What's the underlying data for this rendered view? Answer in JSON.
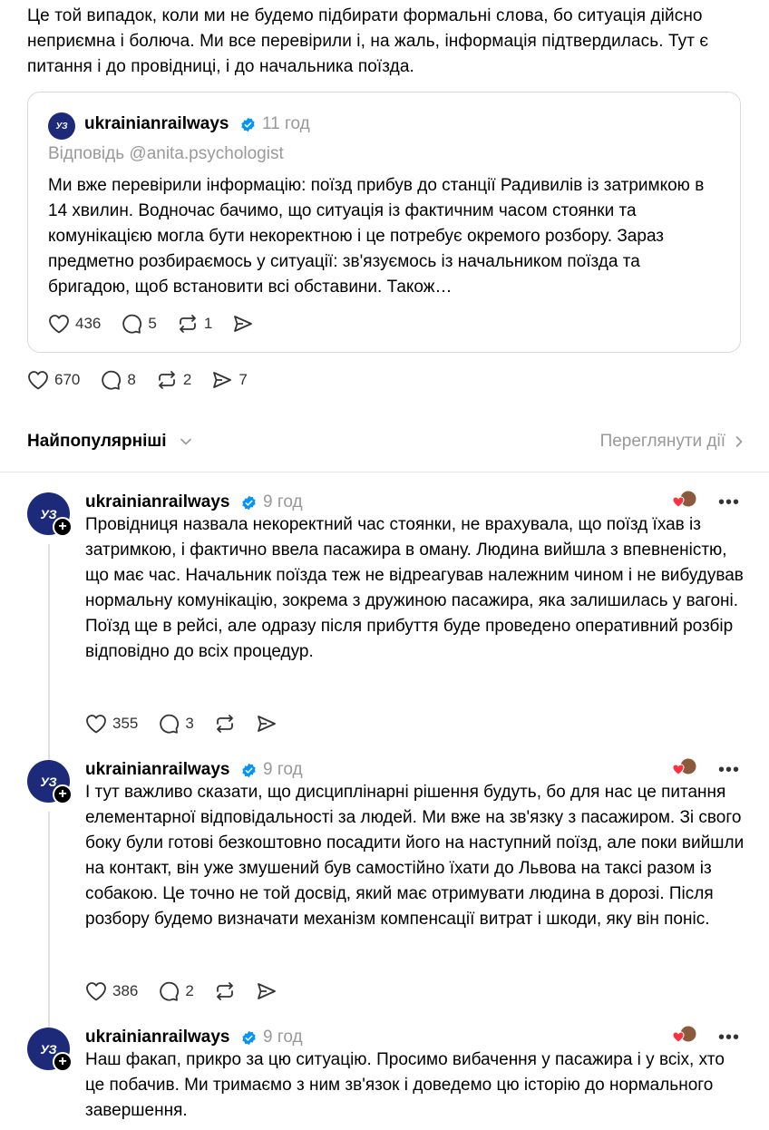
{
  "intro_text": "Це той випадок, коли ми не будемо підбирати формальні слова, бо ситуація дійсно неприємна і болюча. Ми все перевірили і, на жаль, інформація підтвердилась. Тут є питання і до провідниці, і до начальника поїзда.",
  "quoted_post": {
    "username": "ukrainianrailways",
    "time": "11 год",
    "reply_to": "Відповідь @anita.psychologist",
    "text": "Ми вже перевірили інформацію: поїзд прибув до станції Радивилів із затримкою в 14 хвилин. Водночас бачимо, що ситуація із фактичним часом стоянки та комунікацією могла бути некоректною і це потребує окремого розбору. Зараз предметно розбираємось у ситуації: зв'язуємось із начальником поїзда та бригадою, щоб встановити всі обставини. Також…",
    "likes": "436",
    "comments": "5",
    "reposts": "1"
  },
  "main_actions": {
    "likes": "670",
    "comments": "8",
    "reposts": "2",
    "shares": "7"
  },
  "sort": {
    "label": "Найпопулярніші",
    "view_activity": "Переглянути дії"
  },
  "replies": [
    {
      "username": "ukrainianrailways",
      "time": "9 год",
      "text": "Провідниця назвала некоректний час стоянки, не врахувала, що поїзд їхав із затримкою, і фактично ввела пасажира в оману. Людина вийшла з впевненістю, що має час. Начальник поїзда теж не відреагував належним чином і не вибудував нормальну комунікацію, зокрема з дружиною пасажира, яка залишилась у вагоні. Поїзд ще в рейсі, але одразу після прибуття буде проведено оперативний розбір відповідно до всіх процедур.",
      "likes": "355",
      "comments": "3"
    },
    {
      "username": "ukrainianrailways",
      "time": "9 год",
      "text": "І тут важливо сказати, що дисциплінарні рішення будуть, бо для нас це питання елементарної відповідальності за людей. Ми вже на зв'язку з пасажиром. Зі свого боку були готові безкоштовно посадити його на наступний поїзд, але поки вийшли на контакт, він уже змушений був самостійно їхати до Львова на таксі разом із собакою. Це точно не той досвід, який має отримувати людина в дорозі. Після розбору будемо визначати механізм компенсації витрат і шкоди, яку він поніс.",
      "likes": "386",
      "comments": "2"
    },
    {
      "username": "ukrainianrailways",
      "time": "9 год",
      "text": "Наш факап, прикро за цю ситуацію. Просимо вибачення у пасажира і у всіх, хто це побачив. Ми тримаємо з ним зв'язок і доведемо цю історію до нормального завершення."
    }
  ],
  "avatar_text": "УЗ",
  "more_icon": "•••",
  "colors": {
    "avatar_bg": "#1d2a7a",
    "verified": "#0095f6",
    "muted": "#999999",
    "heart": "#ff3040"
  }
}
